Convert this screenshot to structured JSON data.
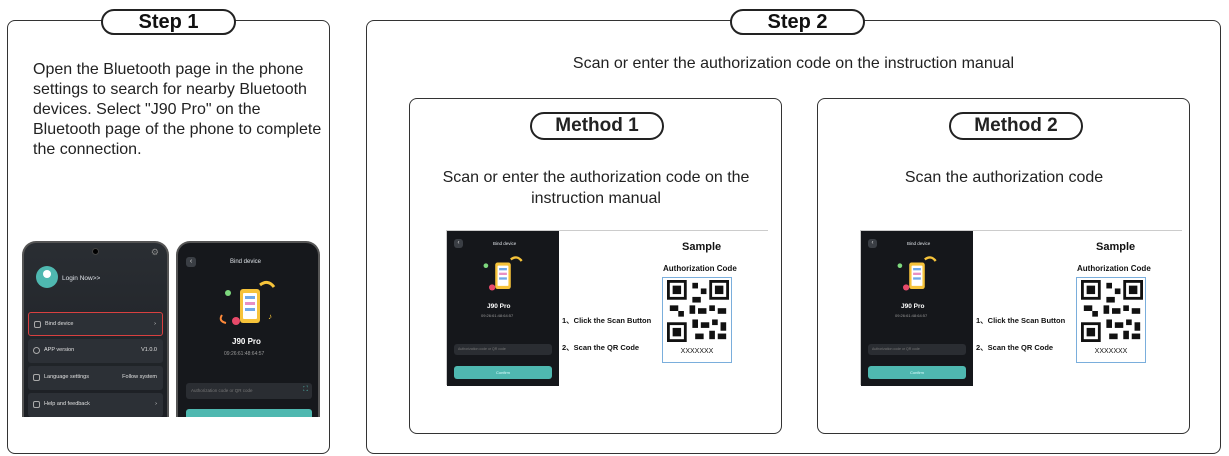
{
  "step1": {
    "label": "Step 1",
    "instruction": "Open the Bluetooth page in the phone settings to search for nearby Bluetooth devices. Select \"J90 Pro\" on the Bluetooth page of the phone to complete the connection.",
    "phone_left": {
      "login": "Login Now>>",
      "menu": [
        {
          "label": "Bind device",
          "right": "",
          "highlighted": true
        },
        {
          "label": "APP version",
          "right": "V1.0.0"
        },
        {
          "label": "Language settings",
          "right": "Follow system"
        },
        {
          "label": "Help and feedback",
          "right": ""
        }
      ]
    },
    "phone_right": {
      "title": "Bind device",
      "device_name": "J90 Pro",
      "device_id": "09:26:61:48:64:57",
      "input_placeholder": "Authorization code or QR code"
    }
  },
  "step2": {
    "label": "Step 2",
    "subtitle": "Scan or enter the authorization code on the instruction manual",
    "method1": {
      "label": "Method 1",
      "description": "Scan or enter the authorization code on the instruction manual"
    },
    "method2": {
      "label": "Method 2",
      "description": "Scan the authorization code"
    },
    "sample": {
      "title": "Sample",
      "auth_label": "Authorization Code",
      "step_a": "1、Click the Scan Button",
      "step_b": "2、Scan the QR Code",
      "code": "XXXXXXX",
      "phone_title": "Bind device",
      "device_name": "J90 Pro",
      "device_id": "09:26:61:48:64:57",
      "input_placeholder": "Authorization code or QR code",
      "confirm": "Confirm"
    }
  },
  "colors": {
    "accent": "#4fb8b0",
    "highlight": "#d94040",
    "border": "#333333"
  }
}
